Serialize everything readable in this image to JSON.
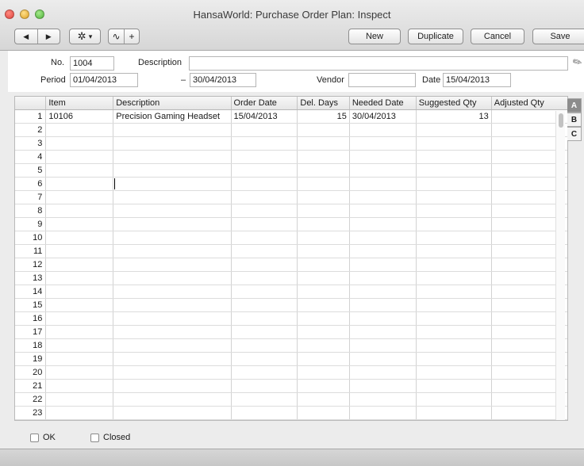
{
  "window": {
    "title": "HansaWorld: Purchase Order Plan: Inspect"
  },
  "toolbar": {
    "prev_icon": "◀",
    "next_icon": "▶",
    "gear_icon": "✲",
    "gear_caret": "▾",
    "wave_icon": "∿",
    "plus_icon": "+",
    "new_label": "New",
    "duplicate_label": "Duplicate",
    "cancel_label": "Cancel",
    "save_label": "Save"
  },
  "header": {
    "no_label": "No.",
    "no_value": "1004",
    "description_label": "Description",
    "description_value": "",
    "period_label": "Period",
    "period_from": "01/04/2013",
    "period_sep": "–",
    "period_to": "30/04/2013",
    "vendor_label": "Vendor",
    "vendor_value": "",
    "date_label": "Date",
    "date_value": "15/04/2013"
  },
  "table": {
    "columns": [
      "",
      "Item",
      "Description",
      "Order Date",
      "Del. Days",
      "Needed Date",
      "Suggested Qty",
      "Adjusted Qty"
    ],
    "rows": [
      [
        "1",
        "10106",
        "Precision Gaming Headset",
        "15/04/2013",
        "15",
        "30/04/2013",
        "13",
        ""
      ],
      [
        "2",
        "",
        "",
        "",
        "",
        "",
        "",
        ""
      ],
      [
        "3",
        "",
        "",
        "",
        "",
        "",
        "",
        ""
      ],
      [
        "4",
        "",
        "",
        "",
        "",
        "",
        "",
        ""
      ],
      [
        "5",
        "",
        "",
        "",
        "",
        "",
        "",
        ""
      ],
      [
        "6",
        "",
        "",
        "",
        "",
        "",
        "",
        ""
      ],
      [
        "7",
        "",
        "",
        "",
        "",
        "",
        "",
        ""
      ],
      [
        "8",
        "",
        "",
        "",
        "",
        "",
        "",
        ""
      ],
      [
        "9",
        "",
        "",
        "",
        "",
        "",
        "",
        ""
      ],
      [
        "10",
        "",
        "",
        "",
        "",
        "",
        "",
        ""
      ],
      [
        "11",
        "",
        "",
        "",
        "",
        "",
        "",
        ""
      ],
      [
        "12",
        "",
        "",
        "",
        "",
        "",
        "",
        ""
      ],
      [
        "13",
        "",
        "",
        "",
        "",
        "",
        "",
        ""
      ],
      [
        "14",
        "",
        "",
        "",
        "",
        "",
        "",
        ""
      ],
      [
        "15",
        "",
        "",
        "",
        "",
        "",
        "",
        ""
      ],
      [
        "16",
        "",
        "",
        "",
        "",
        "",
        "",
        ""
      ],
      [
        "17",
        "",
        "",
        "",
        "",
        "",
        "",
        ""
      ],
      [
        "18",
        "",
        "",
        "",
        "",
        "",
        "",
        ""
      ],
      [
        "19",
        "",
        "",
        "",
        "",
        "",
        "",
        ""
      ],
      [
        "20",
        "",
        "",
        "",
        "",
        "",
        "",
        ""
      ],
      [
        "21",
        "",
        "",
        "",
        "",
        "",
        "",
        ""
      ],
      [
        "22",
        "",
        "",
        "",
        "",
        "",
        "",
        ""
      ],
      [
        "23",
        "",
        "",
        "",
        "",
        "",
        "",
        ""
      ]
    ],
    "side_tabs": [
      "A",
      "B",
      "C"
    ],
    "active_tab": "A"
  },
  "footer": {
    "ok_label": "OK",
    "closed_label": "Closed"
  }
}
